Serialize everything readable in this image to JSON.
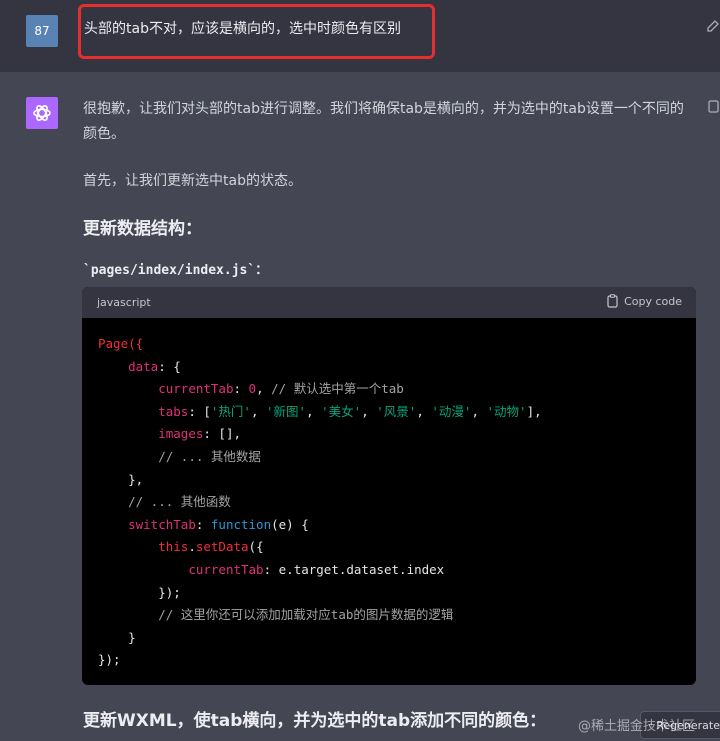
{
  "user_message": {
    "avatar_label": "87",
    "text": "头部的tab不对，应该是横向的，选中时颜色有区别"
  },
  "assistant": {
    "paragraph1": "很抱歉，让我们对头部的tab进行调整。我们将确保tab是横向的，并为选中的tab设置一个不同的颜色。",
    "paragraph2": "首先，让我们更新选中tab的状态。",
    "section_title": "更新数据结构：",
    "file_path": "`pages/index/index.js`：",
    "code_block": {
      "language": "javascript",
      "copy_label": "Copy code",
      "lines": {
        "l1": "Page({",
        "l2_key": "data",
        "l3_key": "currentTab",
        "l3_val": "0",
        "l3_cm": "// 默认选中第一个tab",
        "l4_key": "tabs",
        "l4_s1": "'热门'",
        "l4_s2": "'新图'",
        "l4_s3": "'美女'",
        "l4_s4": "'风景'",
        "l4_s5": "'动漫'",
        "l4_s6": "'动物'",
        "l5_key": "images",
        "l6_cm": "// ... 其他数据",
        "l8_cm": "// ... 其他函数",
        "l9_key": "switchTab",
        "l9_fn": "function",
        "l10_this": "this",
        "l10_method": "setData",
        "l11_key": "currentTab",
        "l11_val": "e.target.dataset.index",
        "l13_cm": "// 这里你还可以添加加载对应tab的图片数据的逻辑"
      }
    },
    "bottom_heading": "更新WXML，使tab横向，并为选中的tab添加不同的颜色："
  },
  "regenerate_label": "Regenerate",
  "watermark": "@稀土掘金技术社区",
  "colors": {
    "highlight_border": "#e42f2f",
    "gpt_avatar": "#ab68ff",
    "user_avatar": "#5a83b5"
  }
}
